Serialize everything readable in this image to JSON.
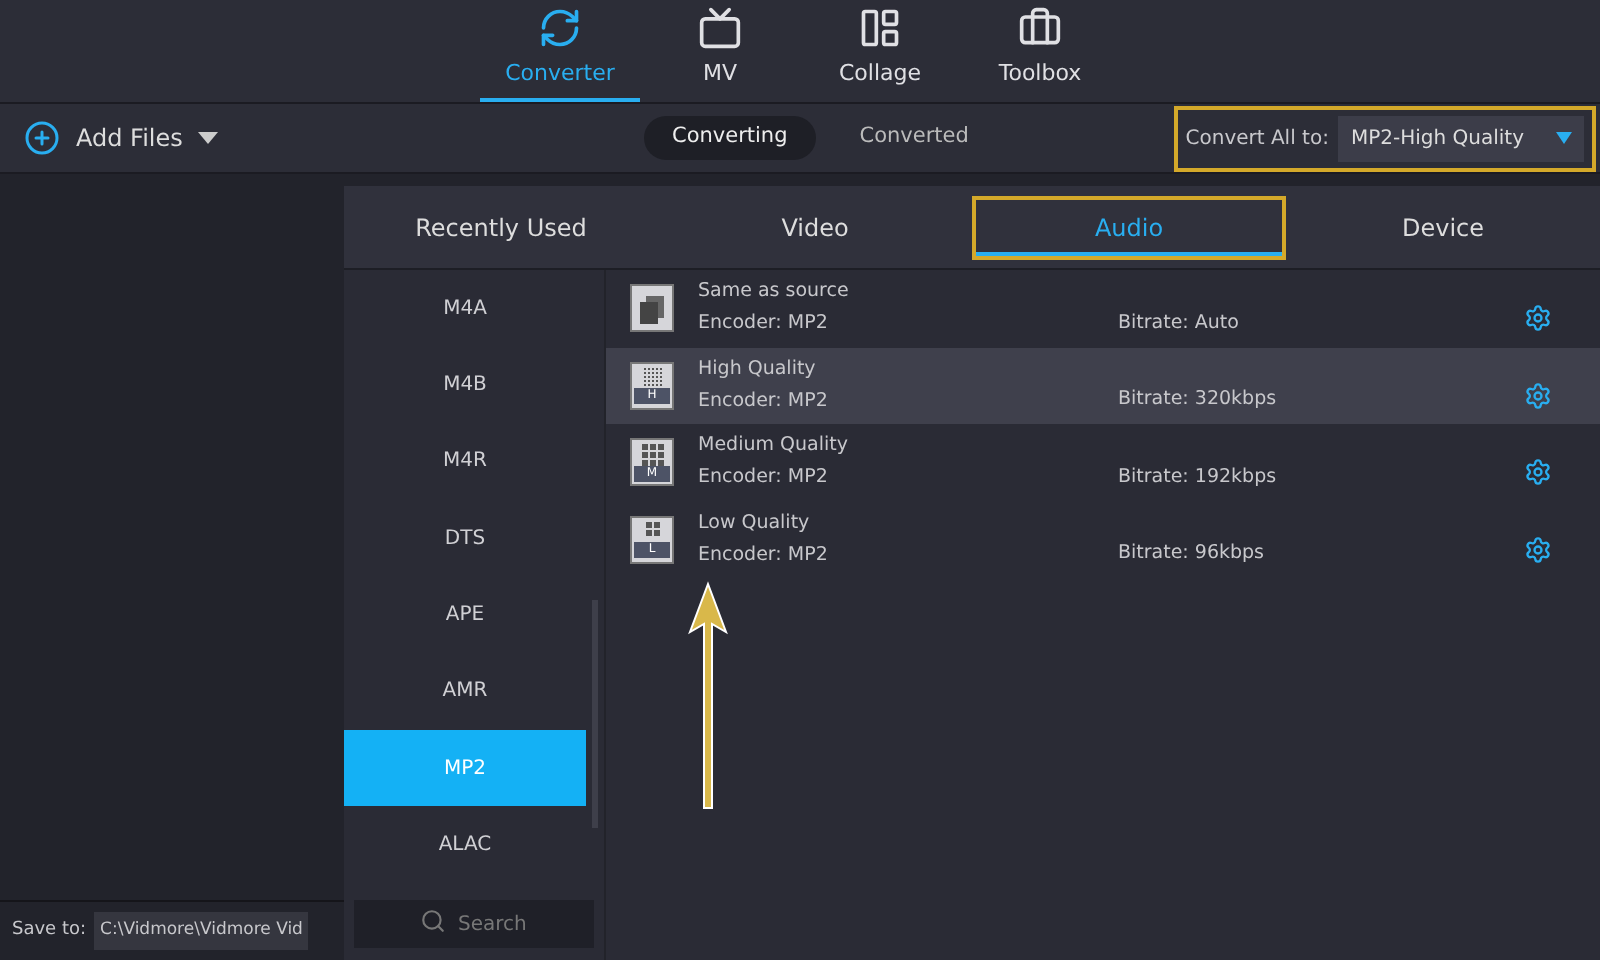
{
  "nav": [
    {
      "label": "Converter",
      "kind": "converter",
      "selected": true
    },
    {
      "label": "MV",
      "kind": "mv",
      "selected": false
    },
    {
      "label": "Collage",
      "kind": "collage",
      "selected": false
    },
    {
      "label": "Toolbox",
      "kind": "toolbox",
      "selected": false
    }
  ],
  "toolbar": {
    "add_files": "Add Files",
    "modes": [
      {
        "label": "Converting",
        "selected": true
      },
      {
        "label": "Converted",
        "selected": false
      }
    ],
    "convert_all_label": "Convert All to:",
    "convert_all_value": "MP2-High Quality"
  },
  "format_tabs": [
    {
      "label": "Recently Used",
      "selected": false
    },
    {
      "label": "Video",
      "selected": false
    },
    {
      "label": "Audio",
      "selected": true
    },
    {
      "label": "Device",
      "selected": false
    }
  ],
  "formats": [
    {
      "label": "M4A",
      "selected": false
    },
    {
      "label": "M4B",
      "selected": false
    },
    {
      "label": "M4R",
      "selected": false
    },
    {
      "label": "DTS",
      "selected": false
    },
    {
      "label": "APE",
      "selected": false
    },
    {
      "label": "AMR",
      "selected": false
    },
    {
      "label": "MP2",
      "selected": true
    },
    {
      "label": "ALAC",
      "selected": false
    }
  ],
  "format_search": {
    "placeholder": "Search"
  },
  "presets": [
    {
      "kind": "source",
      "name": "Same as source",
      "encoder": "Encoder: MP2",
      "bitrate": "Bitrate: Auto",
      "selected": false
    },
    {
      "kind": "high",
      "name": "High Quality",
      "encoder": "Encoder: MP2",
      "bitrate": "Bitrate: 320kbps",
      "badge": "H",
      "selected": true
    },
    {
      "kind": "medium",
      "name": "Medium Quality",
      "encoder": "Encoder: MP2",
      "bitrate": "Bitrate: 192kbps",
      "badge": "M",
      "selected": false
    },
    {
      "kind": "low",
      "name": "Low Quality",
      "encoder": "Encoder: MP2",
      "bitrate": "Bitrate: 96kbps",
      "badge": "L",
      "selected": false
    }
  ],
  "save_to": {
    "label": "Save to:",
    "value": "C:\\Vidmore\\Vidmore Vid"
  }
}
